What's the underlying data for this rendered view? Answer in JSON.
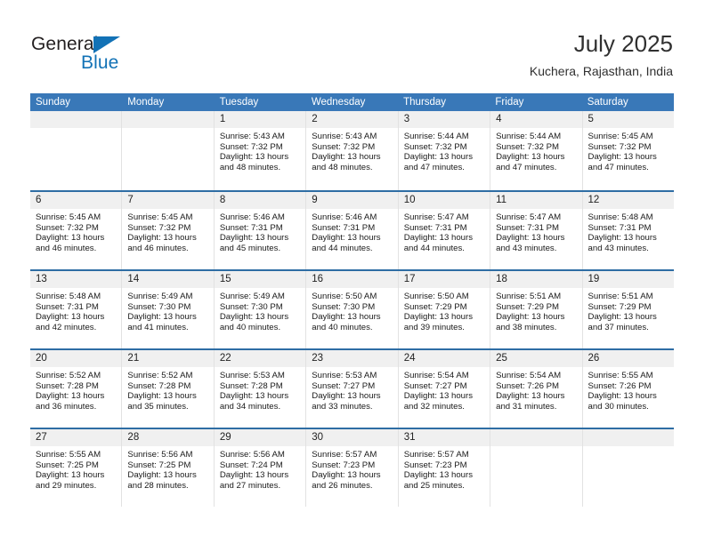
{
  "brand": {
    "name_top": "General",
    "name_bottom": "Blue",
    "triangle_color": "#1272b6"
  },
  "header": {
    "title": "July 2025",
    "subtitle": "Kuchera, Rajasthan, India"
  },
  "colors": {
    "header_blue": "#3978b8",
    "week_separator": "#2e6da4",
    "day_band": "#f0f0f0",
    "brand_blue": "#1272b6"
  },
  "weekdays": [
    "Sunday",
    "Monday",
    "Tuesday",
    "Wednesday",
    "Thursday",
    "Friday",
    "Saturday"
  ],
  "weeks": [
    [
      {
        "day": "",
        "sunrise": "",
        "sunset": "",
        "daylight_line1": "",
        "daylight_line2": ""
      },
      {
        "day": "",
        "sunrise": "",
        "sunset": "",
        "daylight_line1": "",
        "daylight_line2": ""
      },
      {
        "day": "1",
        "sunrise": "Sunrise: 5:43 AM",
        "sunset": "Sunset: 7:32 PM",
        "daylight_line1": "Daylight: 13 hours",
        "daylight_line2": "and 48 minutes."
      },
      {
        "day": "2",
        "sunrise": "Sunrise: 5:43 AM",
        "sunset": "Sunset: 7:32 PM",
        "daylight_line1": "Daylight: 13 hours",
        "daylight_line2": "and 48 minutes."
      },
      {
        "day": "3",
        "sunrise": "Sunrise: 5:44 AM",
        "sunset": "Sunset: 7:32 PM",
        "daylight_line1": "Daylight: 13 hours",
        "daylight_line2": "and 47 minutes."
      },
      {
        "day": "4",
        "sunrise": "Sunrise: 5:44 AM",
        "sunset": "Sunset: 7:32 PM",
        "daylight_line1": "Daylight: 13 hours",
        "daylight_line2": "and 47 minutes."
      },
      {
        "day": "5",
        "sunrise": "Sunrise: 5:45 AM",
        "sunset": "Sunset: 7:32 PM",
        "daylight_line1": "Daylight: 13 hours",
        "daylight_line2": "and 47 minutes."
      }
    ],
    [
      {
        "day": "6",
        "sunrise": "Sunrise: 5:45 AM",
        "sunset": "Sunset: 7:32 PM",
        "daylight_line1": "Daylight: 13 hours",
        "daylight_line2": "and 46 minutes."
      },
      {
        "day": "7",
        "sunrise": "Sunrise: 5:45 AM",
        "sunset": "Sunset: 7:32 PM",
        "daylight_line1": "Daylight: 13 hours",
        "daylight_line2": "and 46 minutes."
      },
      {
        "day": "8",
        "sunrise": "Sunrise: 5:46 AM",
        "sunset": "Sunset: 7:31 PM",
        "daylight_line1": "Daylight: 13 hours",
        "daylight_line2": "and 45 minutes."
      },
      {
        "day": "9",
        "sunrise": "Sunrise: 5:46 AM",
        "sunset": "Sunset: 7:31 PM",
        "daylight_line1": "Daylight: 13 hours",
        "daylight_line2": "and 44 minutes."
      },
      {
        "day": "10",
        "sunrise": "Sunrise: 5:47 AM",
        "sunset": "Sunset: 7:31 PM",
        "daylight_line1": "Daylight: 13 hours",
        "daylight_line2": "and 44 minutes."
      },
      {
        "day": "11",
        "sunrise": "Sunrise: 5:47 AM",
        "sunset": "Sunset: 7:31 PM",
        "daylight_line1": "Daylight: 13 hours",
        "daylight_line2": "and 43 minutes."
      },
      {
        "day": "12",
        "sunrise": "Sunrise: 5:48 AM",
        "sunset": "Sunset: 7:31 PM",
        "daylight_line1": "Daylight: 13 hours",
        "daylight_line2": "and 43 minutes."
      }
    ],
    [
      {
        "day": "13",
        "sunrise": "Sunrise: 5:48 AM",
        "sunset": "Sunset: 7:31 PM",
        "daylight_line1": "Daylight: 13 hours",
        "daylight_line2": "and 42 minutes."
      },
      {
        "day": "14",
        "sunrise": "Sunrise: 5:49 AM",
        "sunset": "Sunset: 7:30 PM",
        "daylight_line1": "Daylight: 13 hours",
        "daylight_line2": "and 41 minutes."
      },
      {
        "day": "15",
        "sunrise": "Sunrise: 5:49 AM",
        "sunset": "Sunset: 7:30 PM",
        "daylight_line1": "Daylight: 13 hours",
        "daylight_line2": "and 40 minutes."
      },
      {
        "day": "16",
        "sunrise": "Sunrise: 5:50 AM",
        "sunset": "Sunset: 7:30 PM",
        "daylight_line1": "Daylight: 13 hours",
        "daylight_line2": "and 40 minutes."
      },
      {
        "day": "17",
        "sunrise": "Sunrise: 5:50 AM",
        "sunset": "Sunset: 7:29 PM",
        "daylight_line1": "Daylight: 13 hours",
        "daylight_line2": "and 39 minutes."
      },
      {
        "day": "18",
        "sunrise": "Sunrise: 5:51 AM",
        "sunset": "Sunset: 7:29 PM",
        "daylight_line1": "Daylight: 13 hours",
        "daylight_line2": "and 38 minutes."
      },
      {
        "day": "19",
        "sunrise": "Sunrise: 5:51 AM",
        "sunset": "Sunset: 7:29 PM",
        "daylight_line1": "Daylight: 13 hours",
        "daylight_line2": "and 37 minutes."
      }
    ],
    [
      {
        "day": "20",
        "sunrise": "Sunrise: 5:52 AM",
        "sunset": "Sunset: 7:28 PM",
        "daylight_line1": "Daylight: 13 hours",
        "daylight_line2": "and 36 minutes."
      },
      {
        "day": "21",
        "sunrise": "Sunrise: 5:52 AM",
        "sunset": "Sunset: 7:28 PM",
        "daylight_line1": "Daylight: 13 hours",
        "daylight_line2": "and 35 minutes."
      },
      {
        "day": "22",
        "sunrise": "Sunrise: 5:53 AM",
        "sunset": "Sunset: 7:28 PM",
        "daylight_line1": "Daylight: 13 hours",
        "daylight_line2": "and 34 minutes."
      },
      {
        "day": "23",
        "sunrise": "Sunrise: 5:53 AM",
        "sunset": "Sunset: 7:27 PM",
        "daylight_line1": "Daylight: 13 hours",
        "daylight_line2": "and 33 minutes."
      },
      {
        "day": "24",
        "sunrise": "Sunrise: 5:54 AM",
        "sunset": "Sunset: 7:27 PM",
        "daylight_line1": "Daylight: 13 hours",
        "daylight_line2": "and 32 minutes."
      },
      {
        "day": "25",
        "sunrise": "Sunrise: 5:54 AM",
        "sunset": "Sunset: 7:26 PM",
        "daylight_line1": "Daylight: 13 hours",
        "daylight_line2": "and 31 minutes."
      },
      {
        "day": "26",
        "sunrise": "Sunrise: 5:55 AM",
        "sunset": "Sunset: 7:26 PM",
        "daylight_line1": "Daylight: 13 hours",
        "daylight_line2": "and 30 minutes."
      }
    ],
    [
      {
        "day": "27",
        "sunrise": "Sunrise: 5:55 AM",
        "sunset": "Sunset: 7:25 PM",
        "daylight_line1": "Daylight: 13 hours",
        "daylight_line2": "and 29 minutes."
      },
      {
        "day": "28",
        "sunrise": "Sunrise: 5:56 AM",
        "sunset": "Sunset: 7:25 PM",
        "daylight_line1": "Daylight: 13 hours",
        "daylight_line2": "and 28 minutes."
      },
      {
        "day": "29",
        "sunrise": "Sunrise: 5:56 AM",
        "sunset": "Sunset: 7:24 PM",
        "daylight_line1": "Daylight: 13 hours",
        "daylight_line2": "and 27 minutes."
      },
      {
        "day": "30",
        "sunrise": "Sunrise: 5:57 AM",
        "sunset": "Sunset: 7:23 PM",
        "daylight_line1": "Daylight: 13 hours",
        "daylight_line2": "and 26 minutes."
      },
      {
        "day": "31",
        "sunrise": "Sunrise: 5:57 AM",
        "sunset": "Sunset: 7:23 PM",
        "daylight_line1": "Daylight: 13 hours",
        "daylight_line2": "and 25 minutes."
      },
      {
        "day": "",
        "sunrise": "",
        "sunset": "",
        "daylight_line1": "",
        "daylight_line2": ""
      },
      {
        "day": "",
        "sunrise": "",
        "sunset": "",
        "daylight_line1": "",
        "daylight_line2": ""
      }
    ]
  ]
}
